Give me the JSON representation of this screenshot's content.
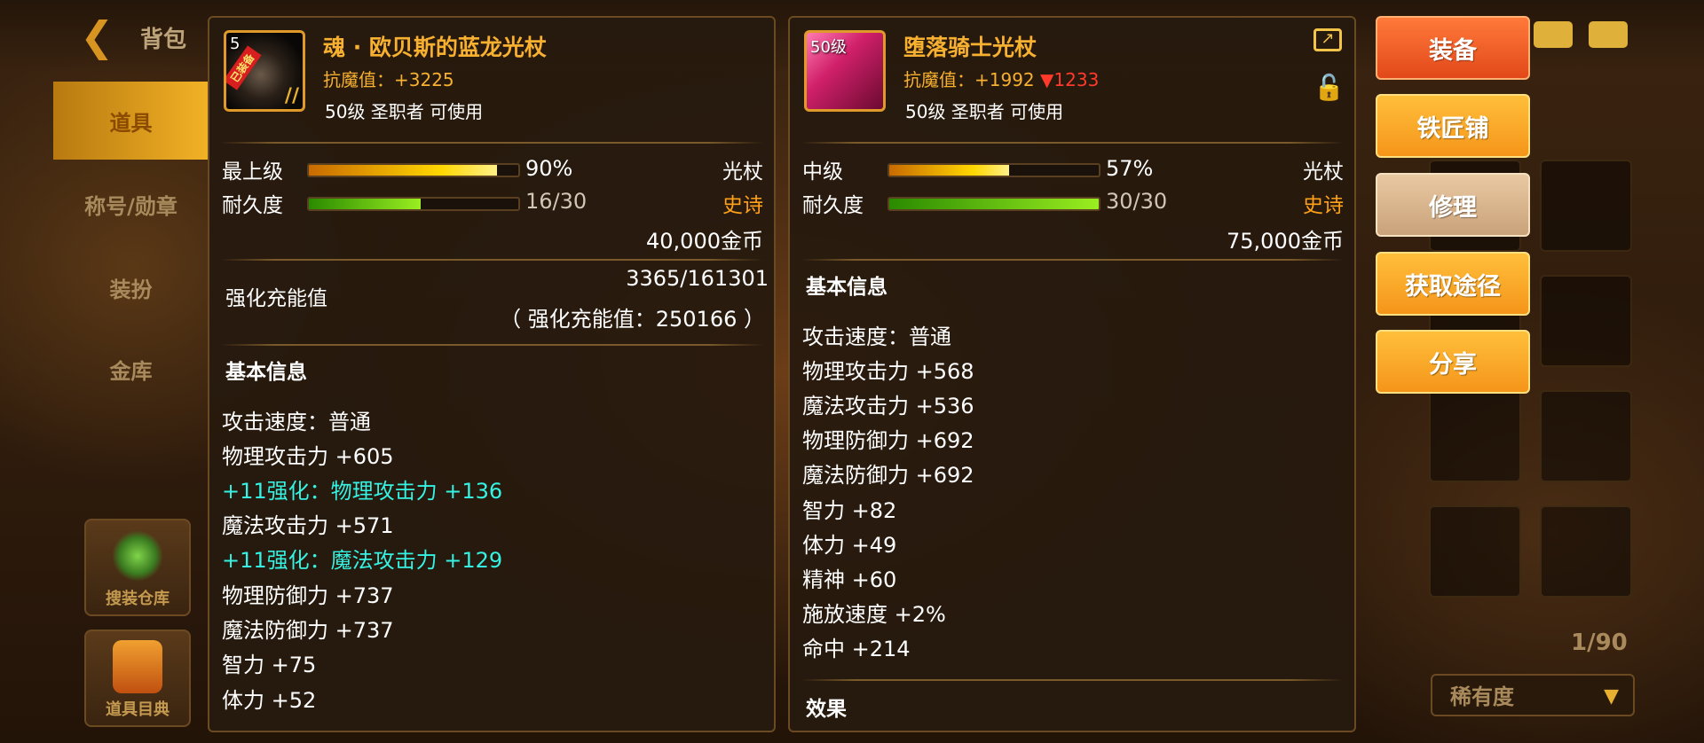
{
  "topbar": {
    "title": "背包"
  },
  "sidebar": {
    "tabs": [
      {
        "label": "道具",
        "active": true
      },
      {
        "label": "称号/勋章",
        "active": false
      },
      {
        "label": "装扮",
        "active": false
      },
      {
        "label": "金库",
        "active": false
      }
    ],
    "shortcuts": [
      {
        "label": "搜装仓库"
      },
      {
        "label": "道具目典"
      }
    ]
  },
  "item_left": {
    "level_tag": "5",
    "badge": "已装备",
    "name": "魂 · 欧贝斯的蓝龙光杖",
    "magic_resist": "抗魔值：+3225",
    "requirement": "50级 圣职者 可使用",
    "grade_label": "最上级",
    "grade_percent": "90%",
    "grade_fill": 0.9,
    "durability_label": "耐久度",
    "durability": "16/30",
    "durability_fill": 0.533,
    "type": "光杖",
    "rarity": "史诗",
    "price": "40,000金币",
    "charge_label": "强化充能值",
    "charge_value": "3365/161301",
    "charge_total": "（ 强化充能值：250166 ）",
    "section_title": "基本信息",
    "stats": [
      {
        "text": "攻击速度：普通",
        "highlight": false
      },
      {
        "text": "物理攻击力 +605",
        "highlight": false
      },
      {
        "text": "+11强化：物理攻击力 +136",
        "highlight": true
      },
      {
        "text": "魔法攻击力 +571",
        "highlight": false
      },
      {
        "text": "+11强化：魔法攻击力 +129",
        "highlight": true
      },
      {
        "text": "物理防御力 +737",
        "highlight": false
      },
      {
        "text": "魔法防御力 +737",
        "highlight": false
      },
      {
        "text": "智力 +75",
        "highlight": false
      },
      {
        "text": "体力 +52",
        "highlight": false
      }
    ]
  },
  "item_right": {
    "level_tag": "50级",
    "name": "堕落骑士光杖",
    "magic_resist": "抗魔值：+1992",
    "magic_resist_diff": "▼1233",
    "requirement": "50级 圣职者 可使用",
    "grade_label": "中级",
    "grade_percent": "57%",
    "grade_fill": 0.57,
    "durability_label": "耐久度",
    "durability": "30/30",
    "durability_fill": 1.0,
    "type": "光杖",
    "rarity": "史诗",
    "price": "75,000金币",
    "section_title": "基本信息",
    "stats": [
      {
        "text": "攻击速度：普通"
      },
      {
        "text": "物理攻击力 +568"
      },
      {
        "text": "魔法攻击力 +536"
      },
      {
        "text": "物理防御力 +692"
      },
      {
        "text": "魔法防御力 +692"
      },
      {
        "text": "智力 +82"
      },
      {
        "text": "体力 +49"
      },
      {
        "text": "精神 +60"
      },
      {
        "text": "施放速度 +2%"
      },
      {
        "text": "命中 +214"
      }
    ],
    "effect_title": "效果"
  },
  "actions": {
    "equip": "装备",
    "smithy": "铁匠铺",
    "repair": "修理",
    "source": "获取途径",
    "share": "分享"
  },
  "inventory": {
    "count": "1/90",
    "sort_label": "稀有度"
  },
  "icons": {
    "back": "back-arrow-icon",
    "mail": "mail-icon",
    "chat": "chat-icon",
    "share": "share-icon",
    "lock": "lock-icon",
    "dropdown": "chevron-down-icon"
  },
  "colors": {
    "item_name": "#f7b030",
    "enhance_stat": "#35f2e2",
    "rarity_epic": "#ffa21a",
    "stat_down": "#ff3a2a",
    "equip_button": "#e2481a",
    "action_button": "#f5951a",
    "repair_button": "#c9a27a"
  }
}
